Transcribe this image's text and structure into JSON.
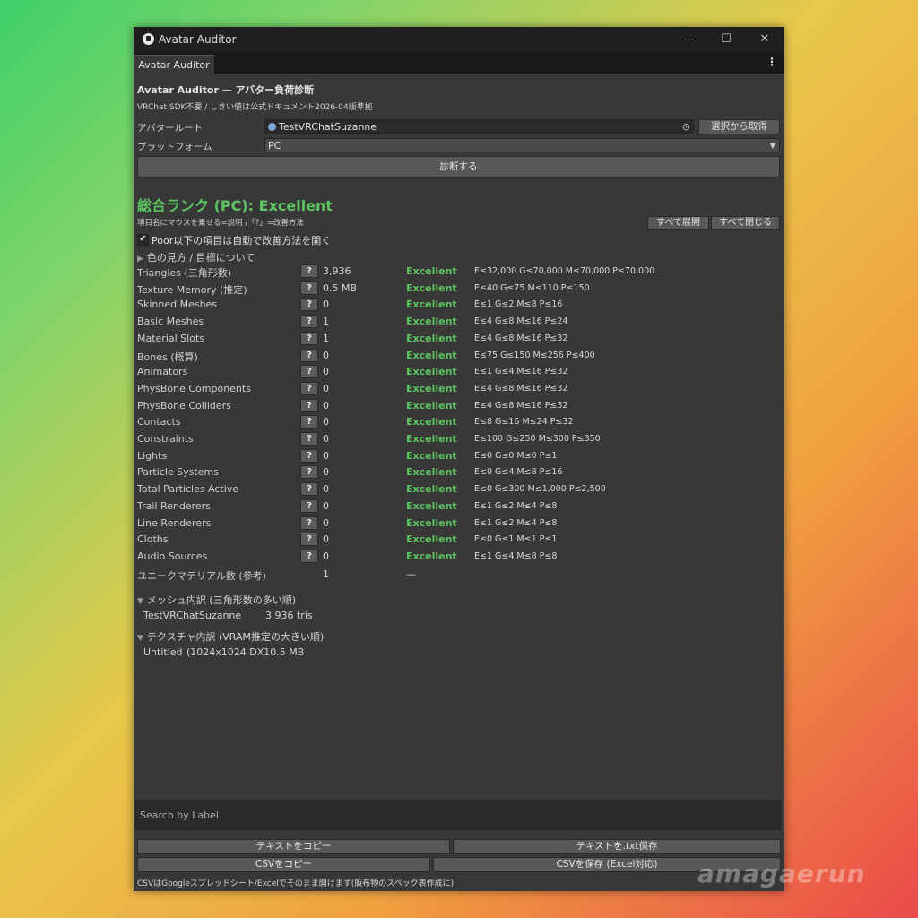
{
  "window": {
    "title": "Avatar Auditor",
    "controls": {
      "minimize": "—",
      "maximize": "☐",
      "close": "✕"
    }
  },
  "tab": {
    "label": "Avatar Auditor",
    "menu_icon": "⋮"
  },
  "header": {
    "title": "Avatar Auditor — アバター負荷診断",
    "subtitle": "VRChat SDK不要 / しきい値は公式ドキュメント2026-04版準拠"
  },
  "form": {
    "avatar_root_label": "アバタールート",
    "avatar_root_value": "TestVRChatSuzanne",
    "select_button": "選択から取得",
    "platform_label": "プラットフォーム",
    "platform_value": "PC",
    "diagnose_button": "診断する"
  },
  "result": {
    "overall_rank": "総合ランク (PC): Excellent",
    "hint": "項目名にマウスを乗せる=説明 /「?」=改善方法",
    "expand_all": "すべて展開",
    "collapse_all": "すべて閉じる",
    "auto_open_checked": true,
    "auto_open_label": "Poor以下の項目は自動で改善方法を開く",
    "legend_fold": "色の見方 / 目標について"
  },
  "metrics": [
    {
      "name": "Triangles (三角形数)",
      "value": "3,936",
      "rank": "Excellent",
      "thresholds": "E≤32,000 G≤70,000 M≤70,000 P≤70,000"
    },
    {
      "name": "Texture Memory (推定)",
      "value": "0.5 MB",
      "rank": "Excellent",
      "thresholds": "E≤40 G≤75 M≤110 P≤150"
    },
    {
      "name": "Skinned Meshes",
      "value": "0",
      "rank": "Excellent",
      "thresholds": "E≤1 G≤2 M≤8 P≤16"
    },
    {
      "name": "Basic Meshes",
      "value": "1",
      "rank": "Excellent",
      "thresholds": "E≤4 G≤8 M≤16 P≤24"
    },
    {
      "name": "Material Slots",
      "value": "1",
      "rank": "Excellent",
      "thresholds": "E≤4 G≤8 M≤16 P≤32"
    },
    {
      "name": "Bones (概算)",
      "value": "0",
      "rank": "Excellent",
      "thresholds": "E≤75 G≤150 M≤256 P≤400"
    },
    {
      "name": "Animators",
      "value": "0",
      "rank": "Excellent",
      "thresholds": "E≤1 G≤4 M≤16 P≤32"
    },
    {
      "name": "PhysBone Components",
      "value": "0",
      "rank": "Excellent",
      "thresholds": "E≤4 G≤8 M≤16 P≤32"
    },
    {
      "name": "PhysBone Colliders",
      "value": "0",
      "rank": "Excellent",
      "thresholds": "E≤4 G≤8 M≤16 P≤32"
    },
    {
      "name": "Contacts",
      "value": "0",
      "rank": "Excellent",
      "thresholds": "E≤8 G≤16 M≤24 P≤32"
    },
    {
      "name": "Constraints",
      "value": "0",
      "rank": "Excellent",
      "thresholds": "E≤100 G≤250 M≤300 P≤350"
    },
    {
      "name": "Lights",
      "value": "0",
      "rank": "Excellent",
      "thresholds": "E≤0 G≤0 M≤0 P≤1"
    },
    {
      "name": "Particle Systems",
      "value": "0",
      "rank": "Excellent",
      "thresholds": "E≤0 G≤4 M≤8 P≤16"
    },
    {
      "name": "Total Particles Active",
      "value": "0",
      "rank": "Excellent",
      "thresholds": "E≤0 G≤300 M≤1,000 P≤2,500"
    },
    {
      "name": "Trail Renderers",
      "value": "0",
      "rank": "Excellent",
      "thresholds": "E≤1 G≤2 M≤4 P≤8"
    },
    {
      "name": "Line Renderers",
      "value": "0",
      "rank": "Excellent",
      "thresholds": "E≤1 G≤2 M≤4 P≤8"
    },
    {
      "name": "Cloths",
      "value": "0",
      "rank": "Excellent",
      "thresholds": "E≤0 G≤1 M≤1 P≤1"
    },
    {
      "name": "Audio Sources",
      "value": "0",
      "rank": "Excellent",
      "thresholds": "E≤1 G≤4 M≤8 P≤8"
    }
  ],
  "unique_materials": {
    "name": "ユニークマテリアル数 (参考)",
    "value": "1",
    "rank": "—"
  },
  "mesh_breakdown": {
    "title": "メッシュ内訳 (三角形数の多い順)",
    "items": [
      {
        "name": "TestVRChatSuzanne",
        "value": "3,936 tris"
      }
    ]
  },
  "texture_breakdown": {
    "title": "テクスチャ内訳 (VRAM推定の大きい順)",
    "items": [
      {
        "name": "Untitled",
        "value": "(1024x1024 DX10.5 MB"
      }
    ]
  },
  "search": {
    "placeholder": "Search by Label"
  },
  "buttons": {
    "copy_text": "テキストをコピー",
    "save_txt": "テキストを.txt保存",
    "copy_csv": "CSVをコピー",
    "save_csv": "CSVを保存 (Excel対応)"
  },
  "footer": {
    "note": "CSVはGoogleスプレッドシート/Excelでそのまま開けます(販布物のスペック表作成に)"
  },
  "watermark": "amagaerun",
  "colors": {
    "excellent": "#5cc460",
    "panel": "#383838",
    "titlebar": "#1f1f1f"
  }
}
